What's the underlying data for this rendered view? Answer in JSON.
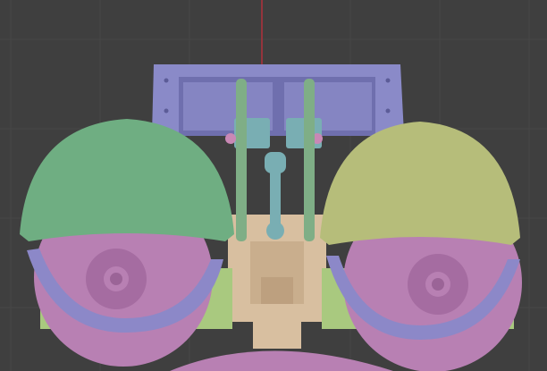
{
  "viewport": {
    "background": "#3f3f3f",
    "grid_color": "#474747",
    "y_axis_color": "#b0313b"
  },
  "model": {
    "frame_color": "#8a8ac8",
    "frame_shadow": "#6f6fae",
    "eyelid_left_color": "#6fae82",
    "eyelid_right_color": "#b6bd7a",
    "eyeball_color": "#b880b3",
    "eyeball_shadow": "#8f5f8c",
    "ring_color": "#8c88c8",
    "mount_color": "#a9c97f",
    "base_color": "#d8bfa0",
    "linkage_color": "#7fae86",
    "servo_color": "#79aeb3",
    "joint_color": "#c988b5"
  }
}
